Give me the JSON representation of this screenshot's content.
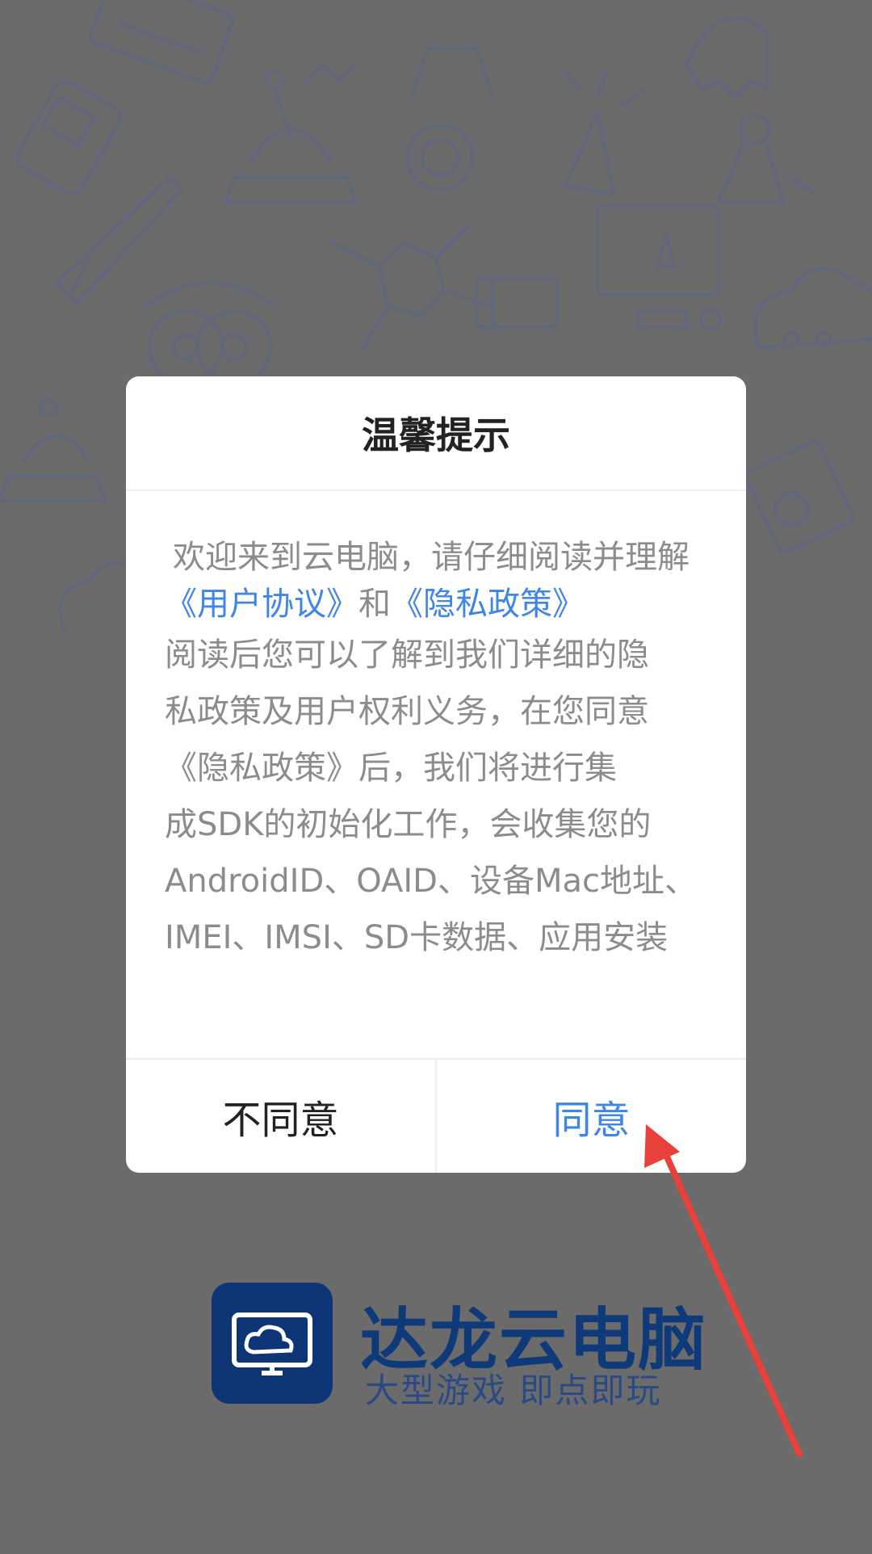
{
  "dialog": {
    "title": "温馨提示",
    "intro": "欢迎来到云电脑，请仔细阅读并理解",
    "user_agreement_link": "《用户协议》",
    "and_text": "和",
    "privacy_policy_link": "《隐私政策》",
    "detail_lines": [
      "阅读后您可以了解到我们详细的隐",
      "私政策及用户权利义务，在您同意",
      "《隐私政策》后，我们将进行集",
      "成SDK的初始化工作，会收集您的",
      "AndroidID、OAID、设备Mac地址、",
      "IMEI、IMSI、SD卡数据、应用安装"
    ],
    "disagree_label": "不同意",
    "agree_label": "同意"
  },
  "brand": {
    "name": "达龙云电脑",
    "slogan": "大型游戏  即点即玩",
    "logo_icon": "cloud-monitor-icon"
  },
  "annotation": {
    "arrow_icon": "red-arrow-icon",
    "color": "#e8403a"
  },
  "colors": {
    "overlay": "#6b6b6b",
    "link": "#3f86e6",
    "brand": "#0f3a7a"
  }
}
